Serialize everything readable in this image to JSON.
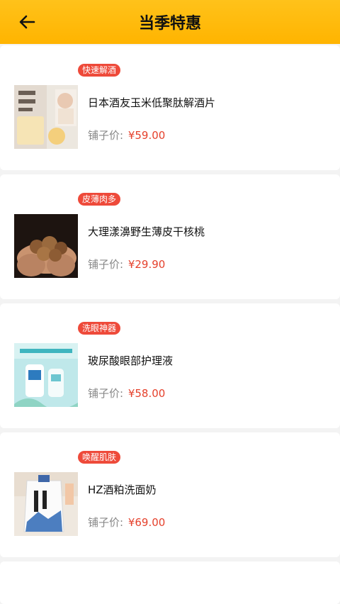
{
  "header": {
    "title": "当季特惠",
    "back_icon": "arrow-left-icon"
  },
  "colors": {
    "header": "#ffb400",
    "tag": "#ee4a3a",
    "price": "#e5412c"
  },
  "products": [
    {
      "tag": "快速解酒",
      "name": "日本酒友玉米低聚肽解酒片",
      "price_label": "铺子价:",
      "price": "¥59.00"
    },
    {
      "tag": "皮薄肉多",
      "name": "大理漾濞野生薄皮干核桃",
      "price_label": "铺子价:",
      "price": "¥29.90"
    },
    {
      "tag": "洗眼神器",
      "name": "玻尿酸眼部护理液",
      "price_label": "铺子价:",
      "price": "¥58.00"
    },
    {
      "tag": "唤醒肌肤",
      "name": "HZ酒粕洗面奶",
      "price_label": "铺子价:",
      "price": "¥69.00"
    }
  ]
}
